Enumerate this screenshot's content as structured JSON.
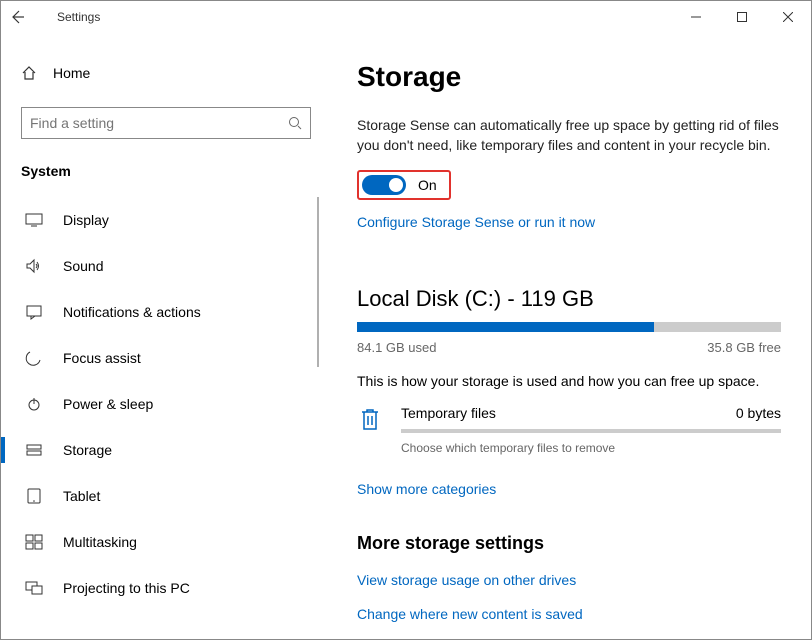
{
  "titlebar": {
    "title": "Settings"
  },
  "sidebar": {
    "home_label": "Home",
    "search_placeholder": "Find a setting",
    "section_label": "System",
    "items": [
      {
        "label": "Display"
      },
      {
        "label": "Sound"
      },
      {
        "label": "Notifications & actions"
      },
      {
        "label": "Focus assist"
      },
      {
        "label": "Power & sleep"
      },
      {
        "label": "Storage"
      },
      {
        "label": "Tablet"
      },
      {
        "label": "Multitasking"
      },
      {
        "label": "Projecting to this PC"
      }
    ]
  },
  "main": {
    "title": "Storage",
    "sense_desc": "Storage Sense can automatically free up space by getting rid of files you don't need, like temporary files and content in your recycle bin.",
    "toggle_label": "On",
    "configure_link": "Configure Storage Sense or run it now",
    "disk_title": "Local Disk (C:) - 119 GB",
    "used_label": "84.1 GB used",
    "free_label": "35.8 GB free",
    "used_percent": 70,
    "usage_desc": "This is how your storage is used and how you can free up space.",
    "temp_label": "Temporary files",
    "temp_size": "0 bytes",
    "temp_sub": "Choose which temporary files to remove",
    "show_more_link": "Show more categories",
    "more_title": "More storage settings",
    "more_links": [
      "View storage usage on other drives",
      "Change where new content is saved"
    ]
  }
}
